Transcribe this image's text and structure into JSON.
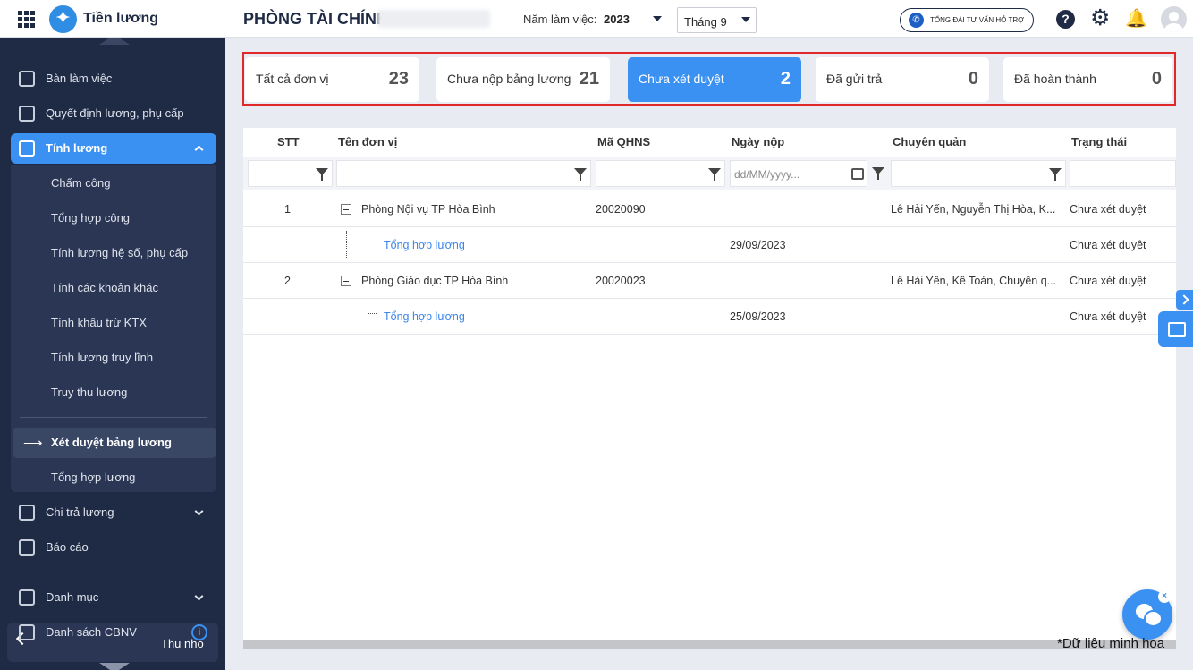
{
  "header": {
    "app_title": "Tiền lương",
    "org_title": "PHÒNG TÀI CHÍNH",
    "year_label": "Năm làm việc:",
    "year_value": "2023",
    "month_value": "Tháng 9",
    "support_label": "TỔNG ĐÀI TƯ VẤN HỖ TRỢ"
  },
  "sidebar": {
    "items": [
      {
        "label": "Bàn làm việc"
      },
      {
        "label": "Quyết định lương, phụ cấp"
      },
      {
        "label": "Tính lương"
      },
      {
        "label": "Chi trả lương"
      },
      {
        "label": "Báo cáo"
      },
      {
        "label": "Danh mục"
      },
      {
        "label": "Danh sách CBNV"
      }
    ],
    "sub_items": [
      {
        "label": "Chấm công"
      },
      {
        "label": "Tổng hợp công"
      },
      {
        "label": "Tính lương hệ số, phụ cấp"
      },
      {
        "label": "Tính các khoản khác"
      },
      {
        "label": "Tính khấu trừ KTX"
      },
      {
        "label": "Tính lương truy lĩnh"
      },
      {
        "label": "Truy thu lương"
      },
      {
        "label": "Xét duyệt bảng lương"
      },
      {
        "label": "Tổng hợp lương"
      }
    ],
    "collapse_label": "Thu nhỏ"
  },
  "stats": [
    {
      "label": "Tất cả đơn vị",
      "count": "23"
    },
    {
      "label": "Chưa nộp bảng lương",
      "count": "21"
    },
    {
      "label": "Chưa xét duyệt",
      "count": "2"
    },
    {
      "label": "Đã gửi trả",
      "count": "0"
    },
    {
      "label": "Đã hoàn thành",
      "count": "0"
    }
  ],
  "table": {
    "columns": [
      "STT",
      "Tên đơn vị",
      "Mã QHNS",
      "Ngày nộp",
      "Chuyên quản",
      "Trạng thái"
    ],
    "date_placeholder": "dd/MM/yyyy...",
    "rows": [
      {
        "stt": "1",
        "name": "Phòng Nội vụ TP Hòa Bình",
        "code": "20020090",
        "date": "",
        "manager": "Lê Hải Yến, Nguyễn Thị  Hòa, K...",
        "status": "Chưa xét duyệt"
      },
      {
        "stt": "",
        "name": "Tổng hợp lương",
        "code": "",
        "date": "29/09/2023",
        "manager": "",
        "status": "Chưa xét duyệt"
      },
      {
        "stt": "2",
        "name": "Phòng Giáo dục TP Hòa Bình",
        "code": "20020023",
        "date": "",
        "manager": "Lê Hải Yến, Kế  Toán, Chuyên q...",
        "status": "Chưa xét duyệt"
      },
      {
        "stt": "",
        "name": "Tổng hợp lương",
        "code": "",
        "date": "25/09/2023",
        "manager": "",
        "status": "Chưa xét duyệt"
      }
    ]
  },
  "note": "*Dữ liệu minh họa",
  "colors": {
    "accent": "#3b91f2",
    "sidebar": "#1f2b44",
    "highlight_border": "#e02828"
  }
}
